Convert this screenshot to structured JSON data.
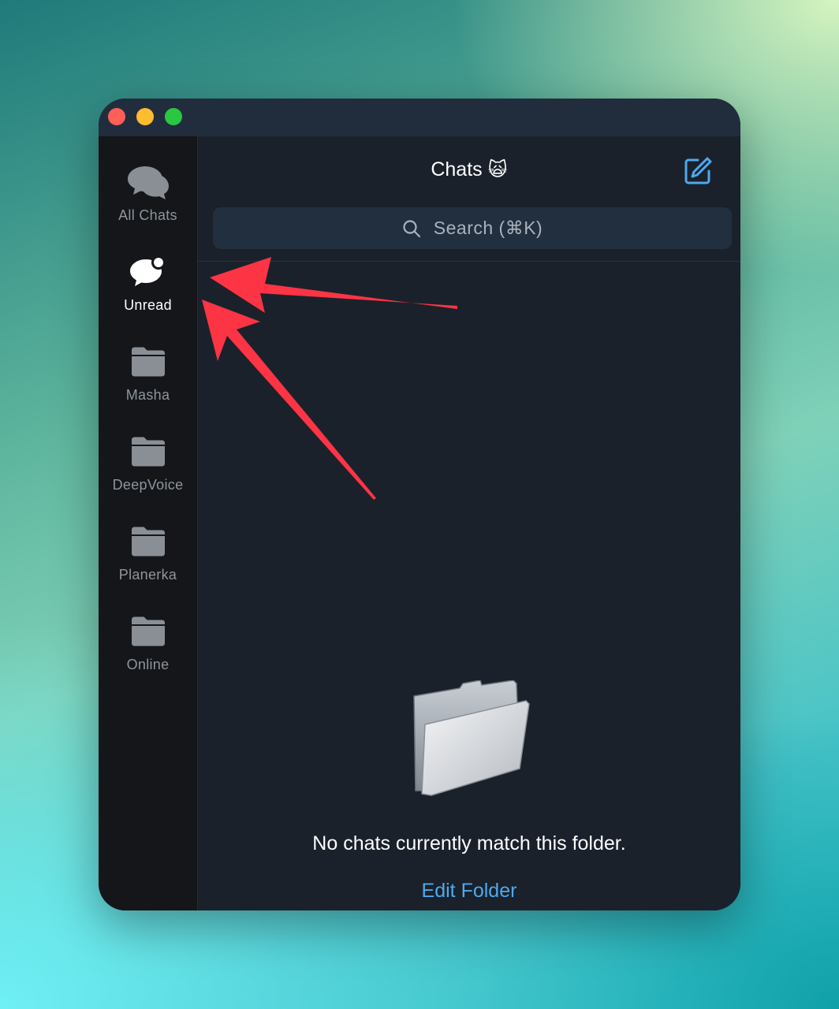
{
  "header": {
    "title": "Chats",
    "title_emoji": "🙀",
    "compose_icon": "compose-icon"
  },
  "search": {
    "placeholder": "Search (⌘K)",
    "icon": "search-icon"
  },
  "sidebar": {
    "items": [
      {
        "label": "All Chats",
        "icon": "chat-bubbles-icon",
        "active": false
      },
      {
        "label": "Unread",
        "icon": "unread-bubble-icon",
        "active": true
      },
      {
        "label": "Masha",
        "icon": "folder-icon",
        "active": false
      },
      {
        "label": "DeepVoice",
        "icon": "folder-icon",
        "active": false
      },
      {
        "label": "Planerka",
        "icon": "folder-icon",
        "active": false
      },
      {
        "label": "Online",
        "icon": "folder-icon",
        "active": false
      }
    ]
  },
  "empty_state": {
    "icon": "empty-folder-icon",
    "message": "No chats currently match this folder.",
    "action_label": "Edit Folder"
  },
  "colors": {
    "accent": "#4ea9ec",
    "annotation_arrow": "#fc3444",
    "sidebar_bg": "#141619",
    "main_bg": "#1a212b"
  }
}
